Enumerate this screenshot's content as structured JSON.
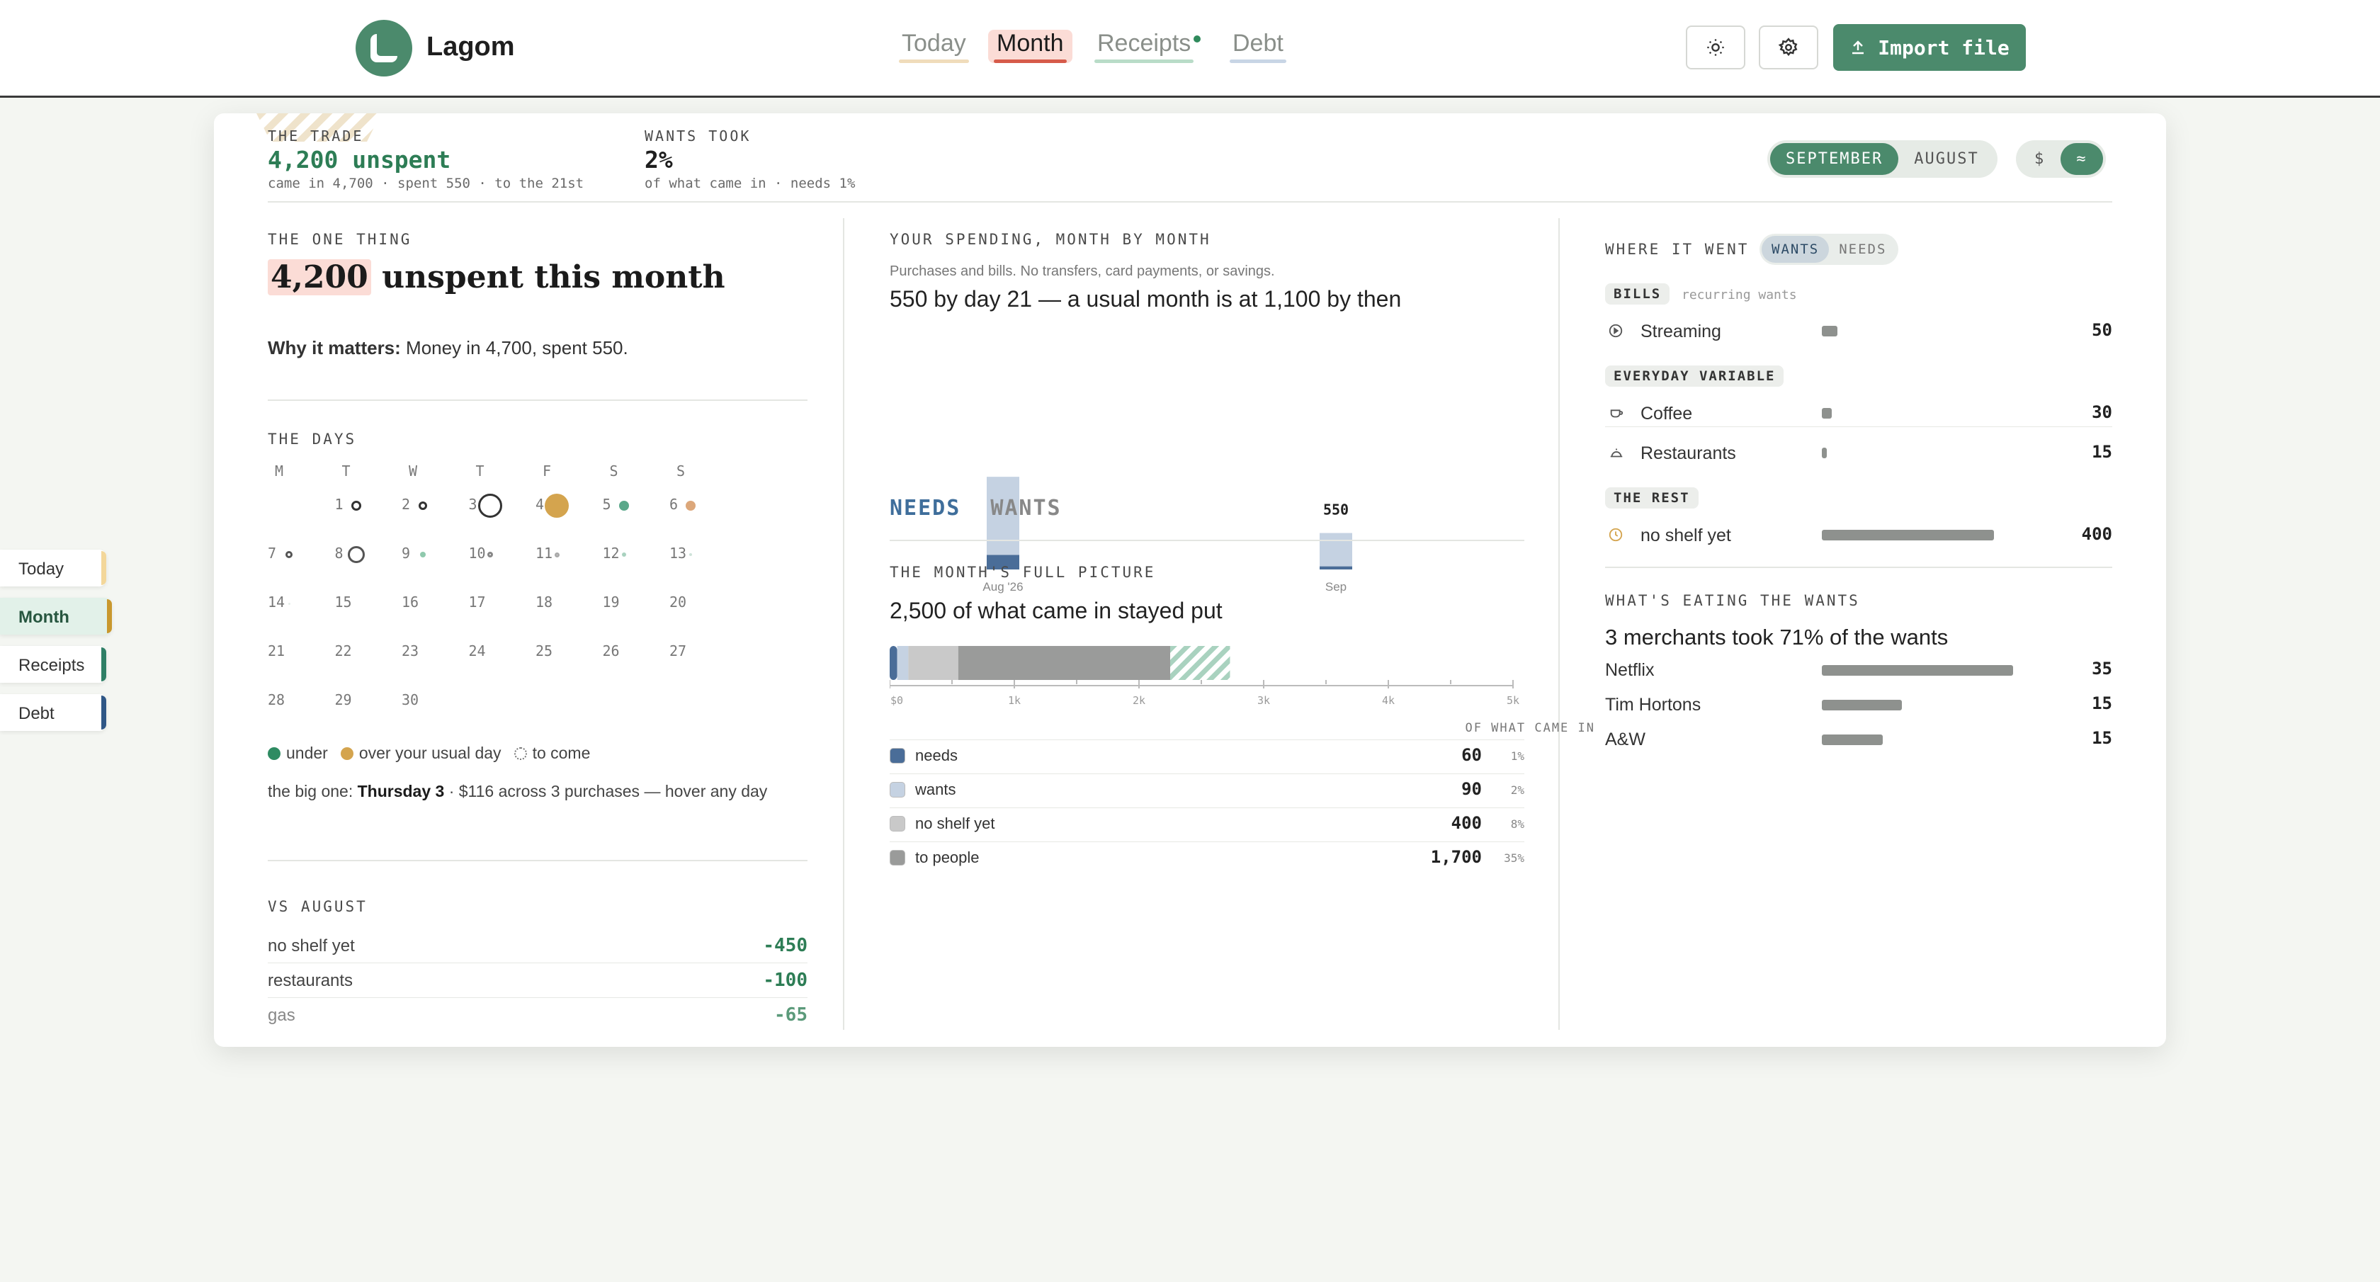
{
  "app": {
    "name": "Lagom"
  },
  "nav": {
    "tabs": [
      "Today",
      "Month",
      "Receipts",
      "Debt"
    ],
    "active": "Month",
    "import_label": "Import file"
  },
  "side_tabs": [
    "Today",
    "Month",
    "Receipts",
    "Debt"
  ],
  "summary": {
    "trade_label": "THE TRADE",
    "trade_value": "4,200 unspent",
    "trade_sub": "came in 4,700 · spent 550 · to the 21st",
    "wants_label": "WANTS TOOK",
    "wants_value": "2%",
    "wants_sub": "of what came in · needs 1%"
  },
  "controls": {
    "months": [
      "SEPTEMBER",
      "AUGUST"
    ],
    "active_month": "SEPTEMBER",
    "modes": [
      "$",
      "≈"
    ],
    "active_mode": "≈"
  },
  "one_thing": {
    "label": "THE ONE THING",
    "highlight": "4,200",
    "headline_rest": "unspent this month",
    "why_label": "Why it matters:",
    "why_text": "Money in 4,700, spent 550."
  },
  "days": {
    "label": "THE DAYS",
    "weekdays": [
      "M",
      "T",
      "W",
      "T",
      "F",
      "S",
      "S"
    ],
    "weeks": [
      [
        "",
        "1",
        "2",
        "3",
        "4",
        "5",
        "6"
      ],
      [
        "7",
        "8",
        "9",
        "10",
        "11",
        "12",
        "13"
      ],
      [
        "14",
        "15",
        "16",
        "17",
        "18",
        "19",
        "20"
      ],
      [
        "21",
        "22",
        "23",
        "24",
        "25",
        "26",
        "27"
      ],
      [
        "28",
        "29",
        "30",
        "",
        "",
        "",
        ""
      ]
    ],
    "legend": {
      "under": "under",
      "over": "over your usual day",
      "to_come": "to come"
    },
    "big_one_prefix": "the big one:",
    "big_one_day": "Thursday 3",
    "big_one_rest": "· $116 across 3 purchases — hover any day"
  },
  "vs": {
    "label": "VS AUGUST",
    "rows": [
      {
        "name": "no shelf yet",
        "value": "-450"
      },
      {
        "name": "restaurants",
        "value": "-100"
      },
      {
        "name": "gas",
        "value": "-65"
      }
    ]
  },
  "spending": {
    "label": "YOUR SPENDING, MONTH BY MONTH",
    "note": "Purchases and bills. No transfers, card payments, or savings.",
    "headline": "550 by day 21 — a usual month is at 1,100 by then",
    "sep_label": "550",
    "tabs": [
      "NEEDS",
      "WANTS"
    ],
    "active_tab": "NEEDS"
  },
  "chart_data": [
    {
      "type": "bar",
      "categories": [
        "Aug '26",
        "Sep"
      ],
      "series": [
        {
          "values": [
            140,
            30
          ]
        },
        {
          "values": [
            750,
            320
          ]
        }
      ],
      "data_labels": [
        "",
        "550"
      ],
      "colors": [
        "#4a6d98",
        "#c5d2e2"
      ]
    },
    {
      "type": "bar",
      "orientation": "horizontal",
      "stacked": true,
      "x_ticks": [
        "$0",
        "1k",
        "2k",
        "3k",
        "4k",
        "5k"
      ],
      "xlim": [
        0,
        5000
      ],
      "segments": [
        {
          "name": "needs",
          "value": 60,
          "color": "#4a6d98"
        },
        {
          "name": "wants",
          "value": 90,
          "color": "#c5d2e2"
        },
        {
          "name": "no shelf yet",
          "value": 400,
          "color": "#c9c9c9"
        },
        {
          "name": "to people",
          "value": 1700,
          "color": "#9a9b9a"
        },
        {
          "name": "to come",
          "value": 480,
          "color": "#a9d2bf"
        }
      ]
    }
  ],
  "picture": {
    "label": "THE MONTH'S FULL PICTURE",
    "headline": "2,500 of what came in stayed put",
    "col_header": "OF WHAT CAME IN",
    "rows": [
      {
        "name": "needs",
        "value": "60",
        "pct": "1%",
        "color": "#4a6d98"
      },
      {
        "name": "wants",
        "value": "90",
        "pct": "2%",
        "color": "#c5d2e2"
      },
      {
        "name": "no shelf yet",
        "value": "400",
        "pct": "8%",
        "color": "#c9c9c9"
      },
      {
        "name": "to people",
        "value": "1,700",
        "pct": "35%",
        "color": "#9a9b9a"
      }
    ]
  },
  "where": {
    "label": "WHERE IT WENT",
    "toggle": [
      "WANTS",
      "NEEDS"
    ],
    "active_toggle": "WANTS",
    "groups": [
      {
        "tag": "BILLS",
        "sub": "recurring wants",
        "items": [
          {
            "name": "Streaming",
            "value": "50",
            "share": 0.08,
            "icon": "play-circle-icon"
          }
        ]
      },
      {
        "tag": "EVERYDAY VARIABLE",
        "sub": "",
        "items": [
          {
            "name": "Coffee",
            "value": "30",
            "share": 0.05,
            "icon": "coffee-cup-icon"
          },
          {
            "name": "Restaurants",
            "value": "15",
            "share": 0.025,
            "icon": "cloche-icon"
          }
        ]
      },
      {
        "tag": "THE REST",
        "sub": "",
        "items": [
          {
            "name": "no shelf yet",
            "value": "400",
            "share": 0.9,
            "icon": "pending-circle-icon"
          }
        ]
      }
    ]
  },
  "eating": {
    "label": "WHAT'S EATING THE WANTS",
    "headline": "3 merchants took 71% of the wants",
    "merchants": [
      {
        "name": "Netflix",
        "value": "35",
        "share": 1.0
      },
      {
        "name": "Tim Hortons",
        "value": "15",
        "share": 0.42
      },
      {
        "name": "A&W",
        "value": "15",
        "share": 0.32
      }
    ]
  }
}
